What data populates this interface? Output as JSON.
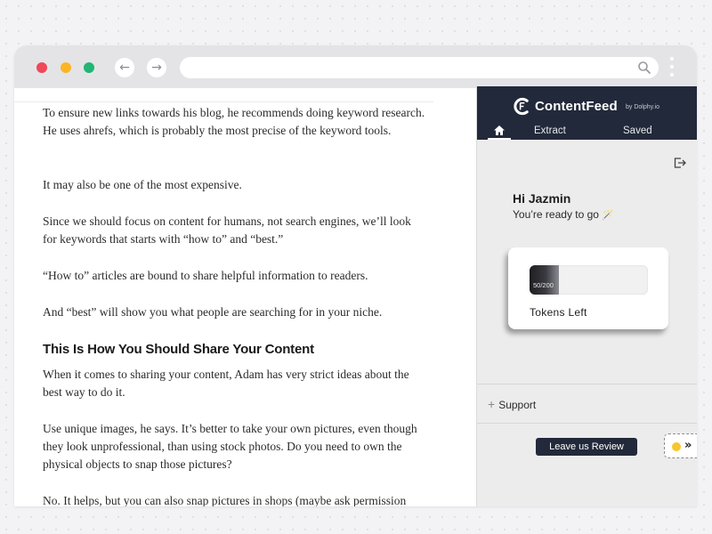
{
  "browser": {
    "back_icon": "←",
    "forward_icon": "→",
    "url": ""
  },
  "article": {
    "paragraphs": [
      "To ensure new links towards his blog, he recommends doing keyword research. He uses ahrefs, which is probably the most precise of the keyword tools.",
      "It may also be one of the most expensive.",
      "Since we should focus on content for humans, not search engines, we’ll look for keywords that starts with “how to” and “best.”",
      "“How to” articles are bound to share helpful information to readers.",
      "And “best” will show you what people are searching for in your niche.",
      "When it comes to sharing your content, Adam has very strict ideas about the best way to do it.",
      "Use unique images, he says. It’s better to take your own pictures, even though they look unprofessional, than using stock photos. Do you need to own the physical objects to snap those pictures?",
      "No. It helps, but you can also snap pictures in shops (maybe ask permission"
    ],
    "heading": "This Is How You Should Share Your Content"
  },
  "extension": {
    "brand": "ContentFeed",
    "byline": "by Dolphy.io",
    "tabs": {
      "extract": "Extract",
      "saved": "Saved"
    },
    "greeting": "Hi Jazmin",
    "subtitle": "You’re ready to go",
    "subtitle_icon": "🪄",
    "tokens": {
      "used": 50,
      "total": 200,
      "display": "50/200",
      "label": "Tokens Left"
    },
    "support": {
      "plus": "+",
      "label": "Support"
    },
    "review_button": "Leave us Review",
    "collapse_icon": "»",
    "colors": {
      "header_bg": "#22293a",
      "panel_bg": "#ececec",
      "accent_yellow": "#f7c72b"
    }
  }
}
